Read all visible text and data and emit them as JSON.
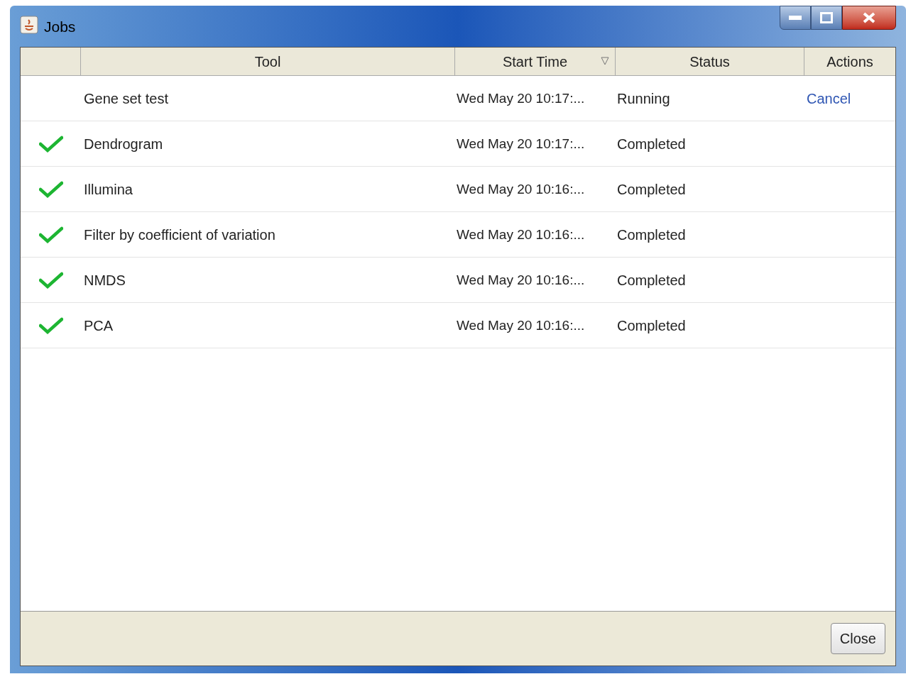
{
  "window": {
    "title": "Jobs"
  },
  "table": {
    "columns": [
      {
        "label": "Tool",
        "sorted": false
      },
      {
        "label": "Start Time",
        "sorted": true
      },
      {
        "label": "Status",
        "sorted": false
      },
      {
        "label": "Actions",
        "sorted": false
      }
    ],
    "rows": [
      {
        "kind": "running",
        "tool": "Gene set test",
        "start_time": "Wed May 20 10:17:...",
        "status": "Running",
        "action": "Cancel"
      },
      {
        "kind": "completed",
        "tool": "Dendrogram",
        "start_time": "Wed May 20 10:17:...",
        "status": "Completed"
      },
      {
        "kind": "completed",
        "tool": "Illumina",
        "start_time": "Wed May 20 10:16:...",
        "status": "Completed"
      },
      {
        "kind": "completed",
        "tool": "Filter by coefficient of variation",
        "start_time": "Wed May 20 10:16:...",
        "status": "Completed"
      },
      {
        "kind": "completed",
        "tool": "NMDS",
        "start_time": "Wed May 20 10:16:...",
        "status": "Completed"
      },
      {
        "kind": "completed",
        "tool": "PCA",
        "start_time": "Wed May 20 10:16:...",
        "status": "Completed"
      }
    ]
  },
  "buttons": [
    "Close"
  ]
}
